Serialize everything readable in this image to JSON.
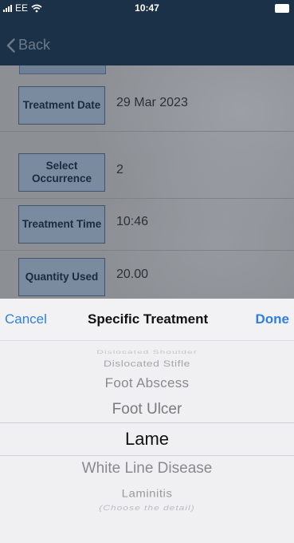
{
  "status_bar": {
    "carrier": "EE",
    "time": "10:47"
  },
  "nav": {
    "back_label": "Back"
  },
  "form": {
    "rows": [
      {
        "label": "Treatment Date",
        "value": "29 Mar 2023"
      },
      {
        "label": "Select Occurrence",
        "value": "2"
      },
      {
        "label": "Treatment Time",
        "value": "10:46"
      },
      {
        "label": "Quantity Used",
        "value": "20.00"
      }
    ]
  },
  "picker": {
    "cancel_label": "Cancel",
    "title": "Specific Treatment",
    "done_label": "Done",
    "options": [
      "Dislocated Shoulder",
      "Dislocated Stifle",
      "Foot Abscess",
      "Foot Ulcer",
      "Lame",
      "White Line Disease",
      "Laminitis",
      "(Choose the detail)"
    ],
    "selected": "Lame"
  },
  "colors": {
    "accent": "#2f7fe2",
    "nav_bg": "#1b3148"
  }
}
